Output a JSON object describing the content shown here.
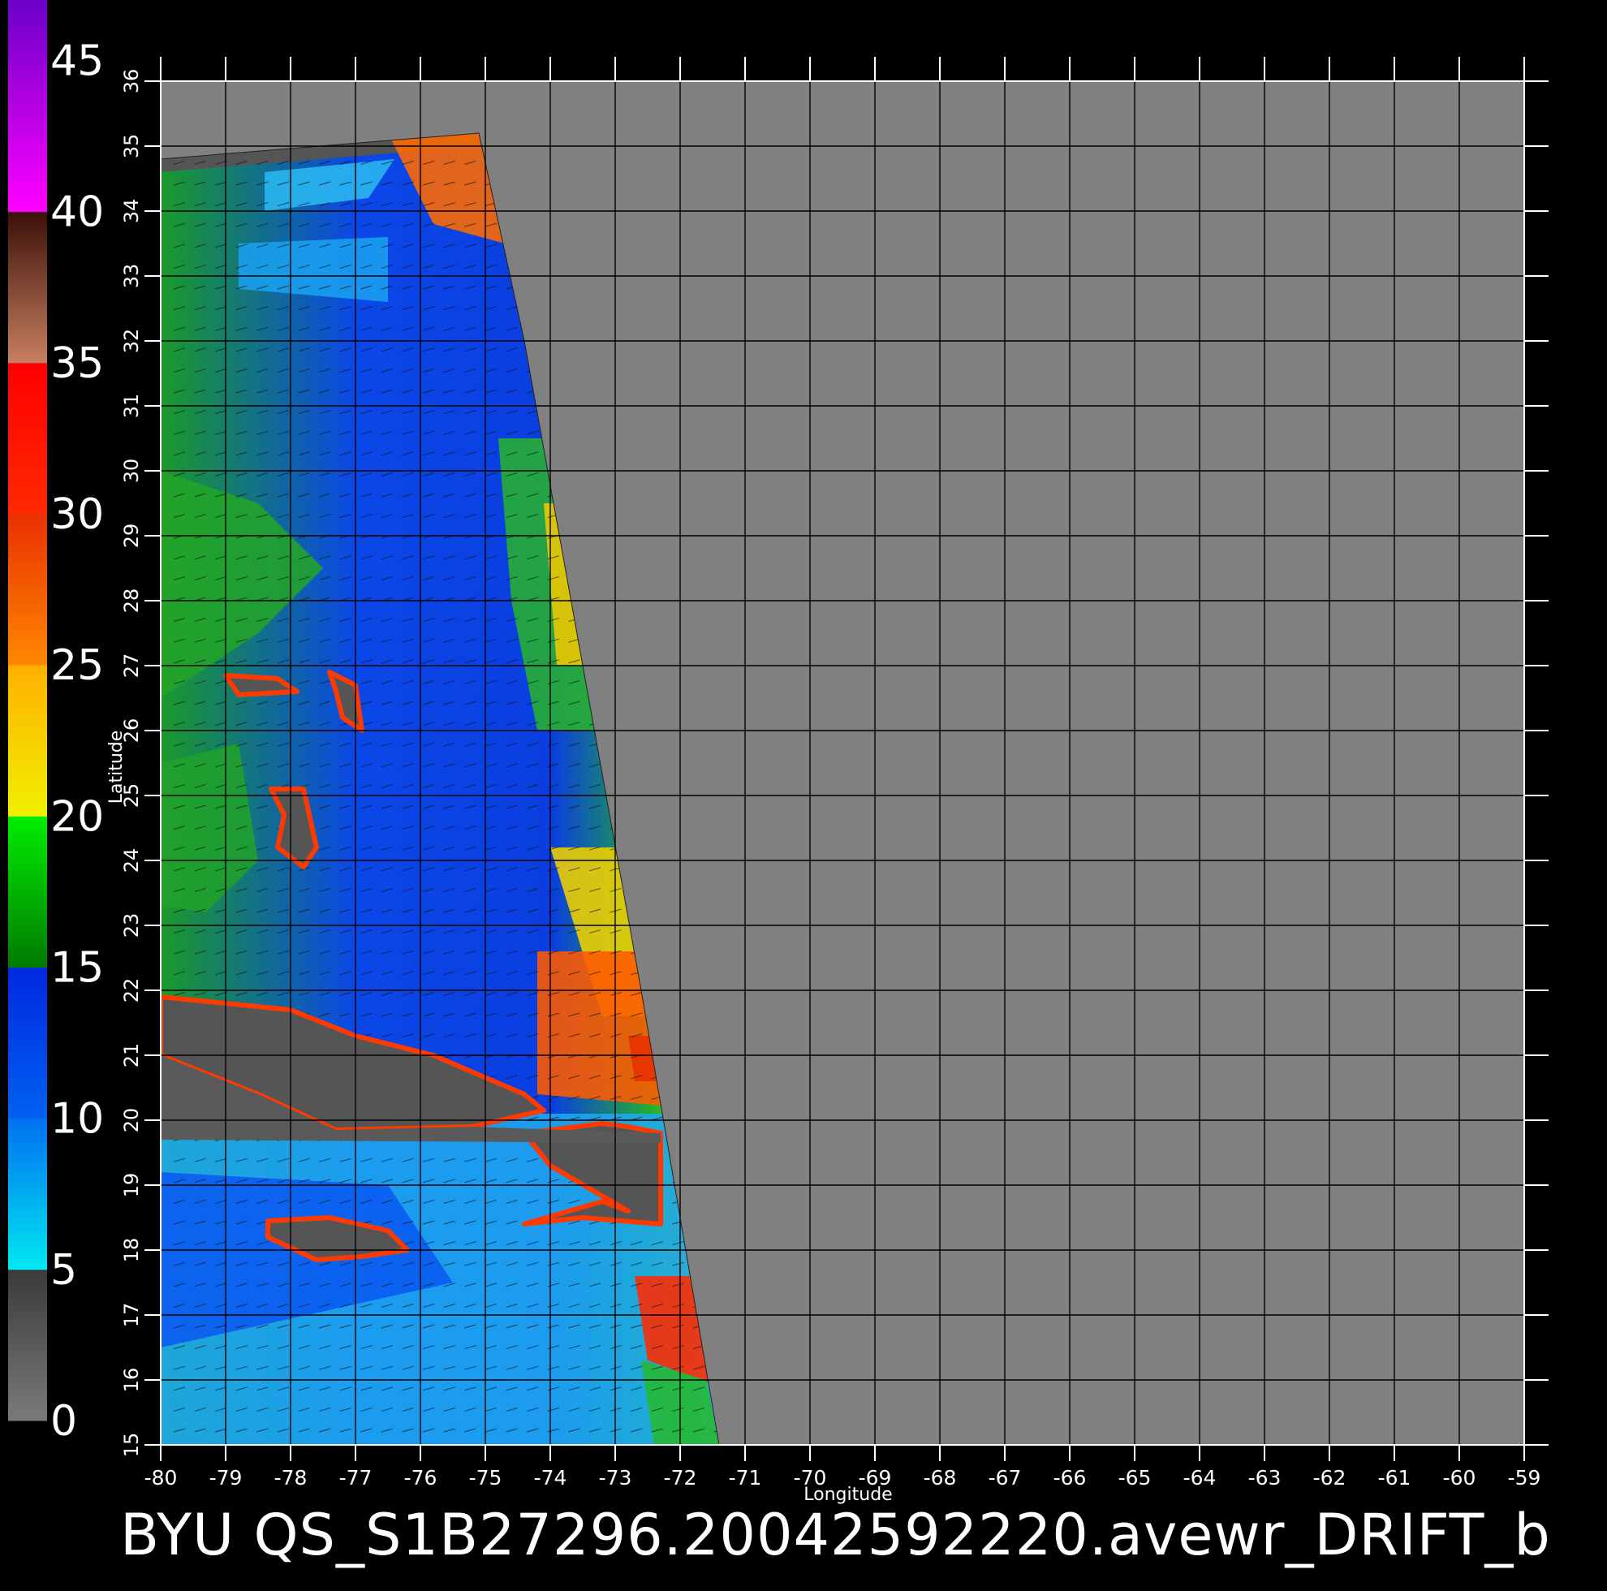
{
  "figure": {
    "caption": "BYU  QS_S1B27296.20042592220.avewr_DRIFT_b",
    "xlabel": "Longitude",
    "ylabel": "Latitude"
  },
  "colorbar": {
    "range": [
      0,
      47
    ],
    "tick_labels": [
      "0",
      "5",
      "10",
      "15",
      "20",
      "25",
      "30",
      "35",
      "40",
      "45"
    ],
    "ticks": [
      0,
      5,
      10,
      15,
      20,
      25,
      30,
      35,
      40,
      45
    ],
    "segments": [
      {
        "from": 0,
        "to": 5,
        "colors": [
          "#7a7a7a",
          "#3a3a3a"
        ]
      },
      {
        "from": 5,
        "to": 10,
        "colors": [
          "#00e8f0",
          "#0070f0"
        ]
      },
      {
        "from": 10,
        "to": 15,
        "colors": [
          "#0060f0",
          "#0028e0"
        ]
      },
      {
        "from": 15,
        "to": 20,
        "colors": [
          "#007a00",
          "#00ee00"
        ]
      },
      {
        "from": 20,
        "to": 25,
        "colors": [
          "#f0f000",
          "#ffb000"
        ]
      },
      {
        "from": 25,
        "to": 30,
        "colors": [
          "#ff8800",
          "#e83000"
        ]
      },
      {
        "from": 30,
        "to": 35,
        "colors": [
          "#ff2a00",
          "#ff0000"
        ]
      },
      {
        "from": 35,
        "to": 40,
        "colors": [
          "#c88060",
          "#3a1008"
        ]
      },
      {
        "from": 40,
        "to": 47,
        "colors": [
          "#ff00ff",
          "#6a00c8"
        ]
      }
    ]
  },
  "chart_data": {
    "type": "heatmap",
    "title": "BYU  QS_S1B27296.20042592220.avewr_DRIFT_b",
    "xlabel": "Longitude",
    "ylabel": "Latitude",
    "xlim": [
      -80,
      -59
    ],
    "ylim": [
      15,
      36
    ],
    "x_ticks": [
      -80,
      -79,
      -78,
      -77,
      -76,
      -75,
      -74,
      -73,
      -72,
      -71,
      -70,
      -69,
      -68,
      -67,
      -66,
      -65,
      -64,
      -63,
      -62,
      -61,
      -60,
      -59
    ],
    "x_tick_labels": [
      "-80",
      "-79",
      "-78",
      "-77",
      "-76",
      "-75",
      "-74",
      "-73",
      "-72",
      "-71",
      "-70",
      "-69",
      "-68",
      "-67",
      "-66",
      "-65",
      "-64",
      "-63",
      "-62",
      "-61",
      "-60",
      "-59"
    ],
    "y_ticks": [
      15,
      16,
      17,
      18,
      19,
      20,
      21,
      22,
      23,
      24,
      25,
      26,
      27,
      28,
      29,
      30,
      31,
      32,
      33,
      34,
      35,
      36
    ],
    "y_tick_labels": [
      "15",
      "16",
      "17",
      "18",
      "19",
      "20",
      "21",
      "22",
      "23",
      "24",
      "25",
      "26",
      "27",
      "28",
      "29",
      "30",
      "31",
      "32",
      "33",
      "34",
      "35",
      "36"
    ],
    "grid": true,
    "background_color": "#808080",
    "swath_outline": [
      [
        -80,
        34.8
      ],
      [
        -75.1,
        35.2
      ],
      [
        -74.4,
        32
      ],
      [
        -73.5,
        27
      ],
      [
        -72.6,
        22
      ],
      [
        -71.4,
        15
      ],
      [
        -80,
        15
      ]
    ],
    "land_color": "#555555",
    "land_outlines": [
      {
        "name": "Cuba",
        "points": [
          [
            -80,
            21.9
          ],
          [
            -78,
            21.7
          ],
          [
            -77,
            21.3
          ],
          [
            -75.8,
            21.0
          ],
          [
            -74.4,
            20.4
          ],
          [
            -74.1,
            20.15
          ],
          [
            -75.2,
            19.9
          ],
          [
            -77.3,
            19.85
          ],
          [
            -78.5,
            20.4
          ],
          [
            -80,
            21.0
          ]
        ]
      },
      {
        "name": "Hispaniola",
        "points": [
          [
            -74.4,
            19.8
          ],
          [
            -73.2,
            19.95
          ],
          [
            -72.8,
            19.9
          ],
          [
            -72.3,
            19.8
          ],
          [
            -72.3,
            18.4
          ],
          [
            -73.5,
            18.5
          ],
          [
            -74.4,
            18.4
          ],
          [
            -73.2,
            18.75
          ],
          [
            -72.8,
            18.6
          ],
          [
            -74.0,
            19.3
          ]
        ]
      },
      {
        "name": "Jamaica",
        "points": [
          [
            -78.35,
            18.45
          ],
          [
            -77.4,
            18.5
          ],
          [
            -76.5,
            18.3
          ],
          [
            -76.2,
            18.0
          ],
          [
            -76.9,
            17.9
          ],
          [
            -77.6,
            17.85
          ],
          [
            -78.35,
            18.2
          ]
        ]
      },
      {
        "name": "Andros",
        "points": [
          [
            -78.3,
            25.1
          ],
          [
            -77.8,
            25.1
          ],
          [
            -77.6,
            24.2
          ],
          [
            -77.8,
            23.9
          ],
          [
            -78.2,
            24.2
          ],
          [
            -78.1,
            24.7
          ]
        ]
      },
      {
        "name": "Grand Bahama",
        "points": [
          [
            -79.0,
            26.85
          ],
          [
            -78.2,
            26.8
          ],
          [
            -77.9,
            26.6
          ],
          [
            -78.8,
            26.55
          ]
        ]
      },
      {
        "name": "Abaco",
        "points": [
          [
            -77.4,
            26.9
          ],
          [
            -77.0,
            26.7
          ],
          [
            -76.9,
            26.0
          ],
          [
            -77.2,
            26.2
          ],
          [
            -77.3,
            26.6
          ]
        ]
      }
    ],
    "wind_speed_bands": [
      {
        "region": "north swath",
        "approx_speed": "10-15"
      },
      {
        "region": "east edge 25N-29N",
        "approx_speed": "20-25"
      },
      {
        "region": "Windward Passage east",
        "approx_speed": "25-32"
      },
      {
        "region": "Caribbean south of Hispaniola",
        "approx_speed": "30-35"
      },
      {
        "region": "Caribbean west",
        "approx_speed": "5-12"
      }
    ]
  }
}
